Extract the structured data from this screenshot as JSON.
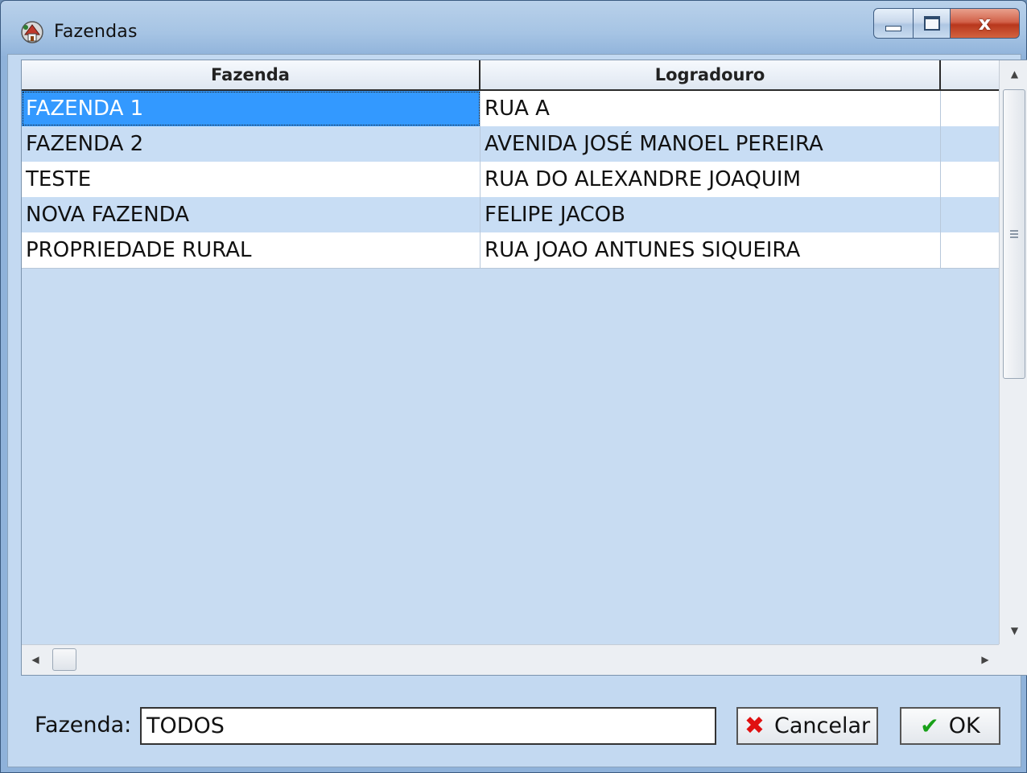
{
  "window": {
    "title": "Fazendas",
    "controls": {
      "minimize": "minimize",
      "maximize": "maximize",
      "close": "x"
    }
  },
  "grid": {
    "columns": [
      "Fazenda",
      "Logradouro",
      ""
    ],
    "rows": [
      {
        "fazenda": "FAZENDA 1",
        "logradouro": "RUA A",
        "selected": true
      },
      {
        "fazenda": "FAZENDA 2",
        "logradouro": "AVENIDA JOSÉ MANOEL PEREIRA",
        "selected": false
      },
      {
        "fazenda": "TESTE",
        "logradouro": "RUA DO ALEXANDRE JOAQUIM",
        "selected": false
      },
      {
        "fazenda": "NOVA FAZENDA",
        "logradouro": "FELIPE JACOB",
        "selected": false
      },
      {
        "fazenda": "PROPRIEDADE RURAL",
        "logradouro": "RUA JOAO ANTUNES SIQUEIRA",
        "selected": false
      }
    ]
  },
  "footer": {
    "label": "Fazenda:",
    "input_value": "TODOS",
    "cancel_label": "Cancelar",
    "ok_label": "OK"
  },
  "colors": {
    "selection": "#3399ff",
    "row_alt": "#c8ddf4",
    "cancel_icon": "#e01010",
    "ok_icon": "#18a018"
  }
}
